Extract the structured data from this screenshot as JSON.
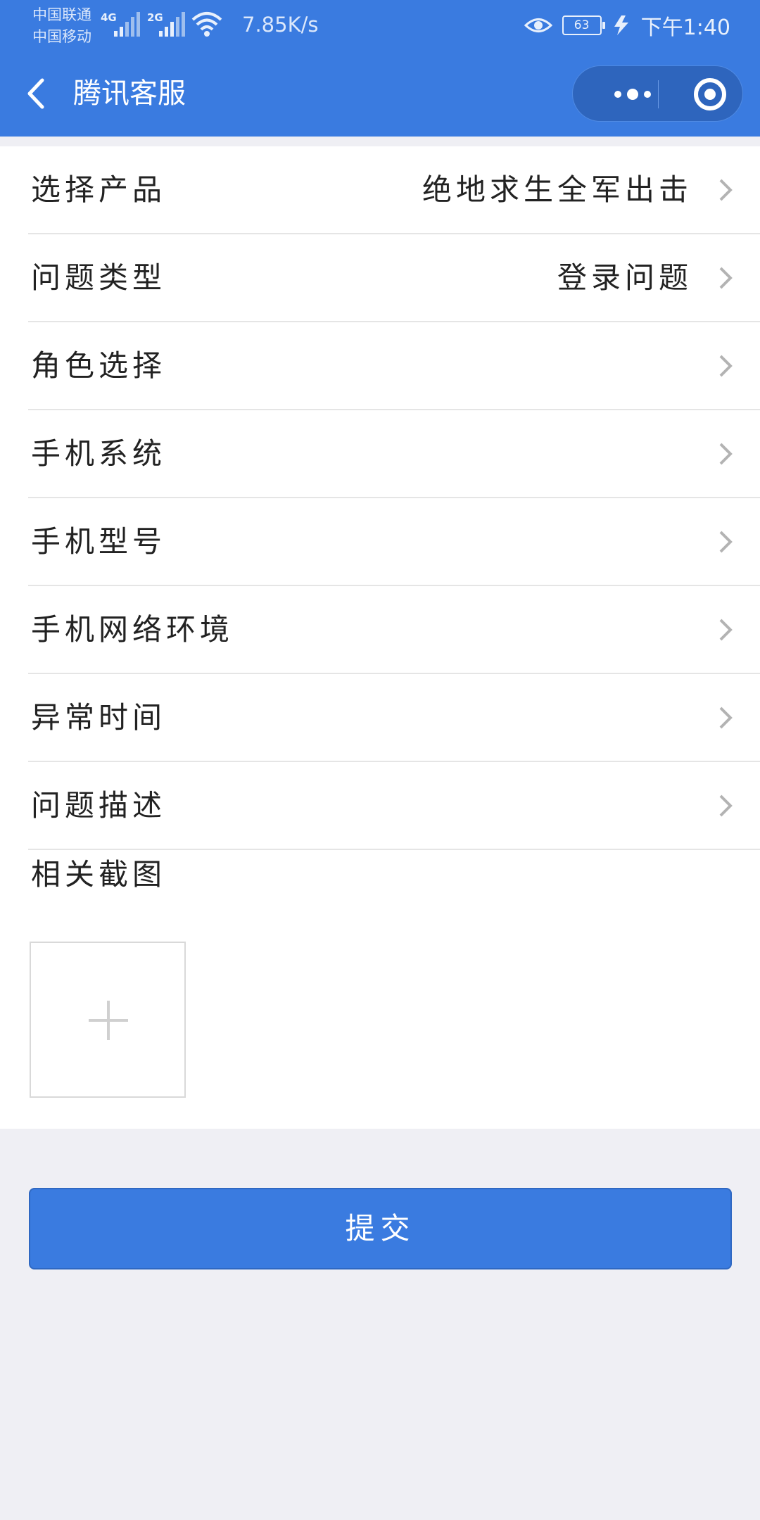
{
  "status_bar": {
    "carrier_1": "中国联通",
    "carrier_2": "中国移动",
    "net_1": "4G",
    "net_2": "2G",
    "speed": "7.85K/s",
    "battery": "63",
    "time": "下午1:40"
  },
  "nav": {
    "title": "腾讯客服"
  },
  "form": {
    "rows": [
      {
        "label": "选择产品",
        "value": "绝地求生全军出击"
      },
      {
        "label": "问题类型",
        "value": "登录问题"
      },
      {
        "label": "角色选择",
        "value": ""
      },
      {
        "label": "手机系统",
        "value": ""
      },
      {
        "label": "手机型号",
        "value": ""
      },
      {
        "label": "手机网络环境",
        "value": ""
      },
      {
        "label": "异常时间",
        "value": ""
      },
      {
        "label": "问题描述",
        "value": ""
      }
    ],
    "screenshot_label": "相关截图"
  },
  "submit_label": "提交",
  "colors": {
    "accent": "#3a7be0",
    "background": "#efeff4"
  }
}
